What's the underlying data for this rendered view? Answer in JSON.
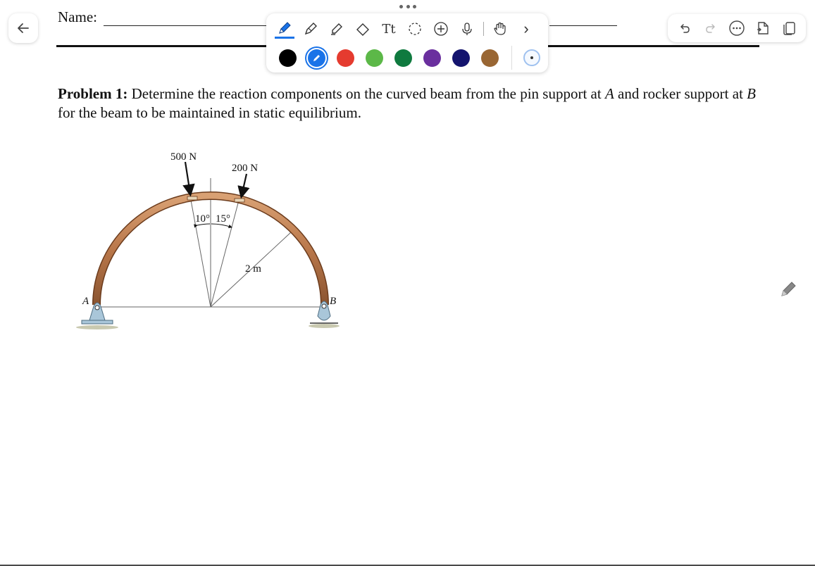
{
  "document": {
    "name_label": "Name:",
    "problem_label": "Problem 1:",
    "problem_text_1": " Determine the reaction components on the curved beam from the pin support at ",
    "point_a": "A",
    "problem_text_2": " and rocker support at ",
    "point_b": "B",
    "problem_text_3": " for the beam to be maintained in static equilibrium."
  },
  "figure": {
    "force_1": "500 N",
    "force_2": "200 N",
    "angle_1": "10°",
    "angle_2": "15°",
    "radius": "2 m",
    "support_a": "A",
    "support_b": "B"
  },
  "toolbar": {
    "tools": [
      "pen-icon",
      "pencil-icon",
      "highlighter-icon",
      "eraser-icon",
      "text-tool-icon",
      "lasso-icon",
      "add-icon",
      "microphone-icon",
      "hand-icon",
      "more-chevron-icon"
    ],
    "text_tool_label": "Tt",
    "colors": [
      "#000000",
      "#1a73e8",
      "#e53b2f",
      "#5cb848",
      "#0f7a3f",
      "#6a2f9e",
      "#14146e",
      "#996633"
    ],
    "selected_color": "#1a73e8",
    "chevron": "›"
  },
  "top_right": {
    "icons": [
      "undo-icon",
      "redo-icon",
      "more-icon",
      "export-icon",
      "pages-icon"
    ]
  }
}
